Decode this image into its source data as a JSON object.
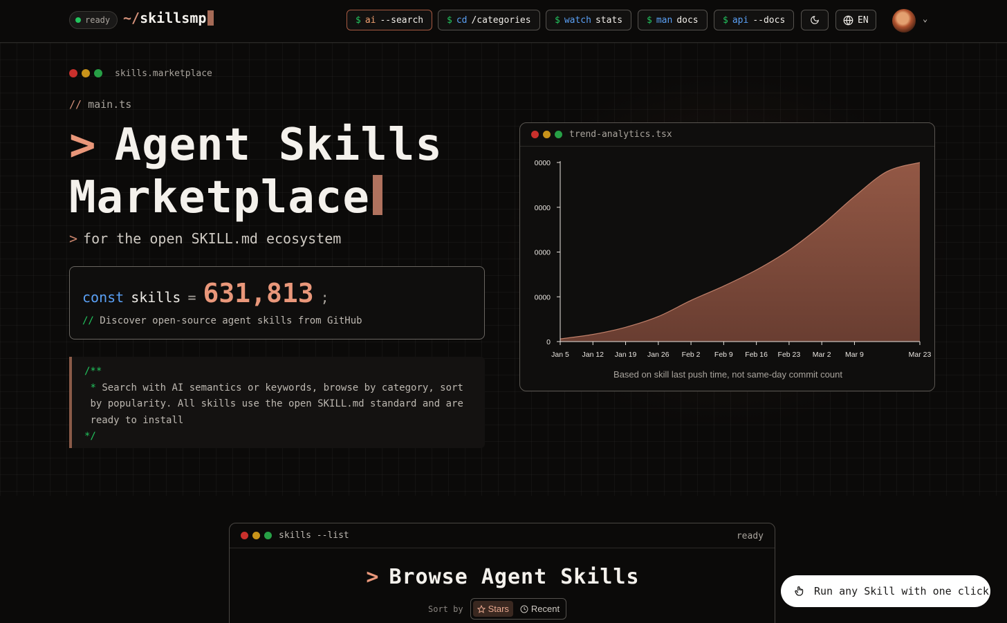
{
  "nav": {
    "status": "ready",
    "brand_prefix": "~/",
    "brand_name": "skillsmp",
    "buttons": [
      {
        "ps": "$",
        "cmd": "ai",
        "arg": "--search"
      },
      {
        "ps": "$",
        "cmd": "cd",
        "arg": "/categories"
      },
      {
        "ps": "$",
        "cmd": "watch",
        "arg": "stats"
      },
      {
        "ps": "$",
        "cmd": "man",
        "arg": "docs"
      },
      {
        "ps": "$",
        "cmd": "api",
        "arg": "--docs"
      }
    ],
    "language": "EN",
    "theme_icon": "moon-icon",
    "language_icon": "globe-icon"
  },
  "hero": {
    "window_title": "skills.marketplace",
    "file_comment_slashes": "//",
    "file_comment": "main.ts",
    "title_prompt": ">",
    "title_line1": "Agent Skills",
    "title_line2": "Marketplace",
    "subtitle_prompt": ">",
    "subtitle": "for the open SKILL.md ecosystem",
    "const_keyword": "const",
    "const_ident": "skills",
    "const_eq": "=",
    "skills_count": "631,813",
    "const_semi": ";",
    "const_comment_slashes": "//",
    "const_comment": "Discover open-source agent skills from GitHub",
    "doc_open": "/**",
    "doc_star": "*",
    "doc_lines": [
      "Search with AI semantics or keywords, browse by category, sort",
      "by popularity. All skills use the open SKILL.md standard and are",
      "ready to install"
    ],
    "doc_close": "*/"
  },
  "trend": {
    "window_title": "trend-analytics.tsx",
    "note": "Based on skill last push time, not same-day commit count"
  },
  "chart_data": {
    "type": "area",
    "x_labels": [
      "Jan 5",
      "Jan 12",
      "Jan 19",
      "Jan 26",
      "Feb 2",
      "Feb 9",
      "Feb 16",
      "Feb 23",
      "Mar 2",
      "Mar 9",
      "Mar 23"
    ],
    "y_tick_labels": [
      "0",
      "0000",
      "0000",
      "0000",
      "0000"
    ],
    "series": [
      {
        "color": "#a0604c",
        "x": [
          "Jan 5",
          "Jan 12",
          "Jan 19",
          "Jan 26",
          "Feb 2",
          "Feb 9",
          "Feb 16",
          "Feb 23",
          "Mar 2",
          "Mar 9",
          "Mar 16",
          "Mar 23"
        ],
        "values": [
          1.5,
          4,
          8,
          14,
          23,
          31,
          40,
          51,
          65,
          81,
          95,
          100
        ]
      }
    ],
    "ylim": [
      0,
      100
    ],
    "grid": false,
    "legend": "none"
  },
  "browse": {
    "window_title": "skills --list",
    "status": "ready",
    "title_prompt": ">",
    "title": "Browse Agent Skills",
    "sort_label": "Sort by",
    "sort_options": [
      "Stars",
      "Recent"
    ],
    "sort_selected": "Stars"
  },
  "cta": {
    "label": "Run any Skill with one click",
    "icon": "pointer-icon"
  }
}
